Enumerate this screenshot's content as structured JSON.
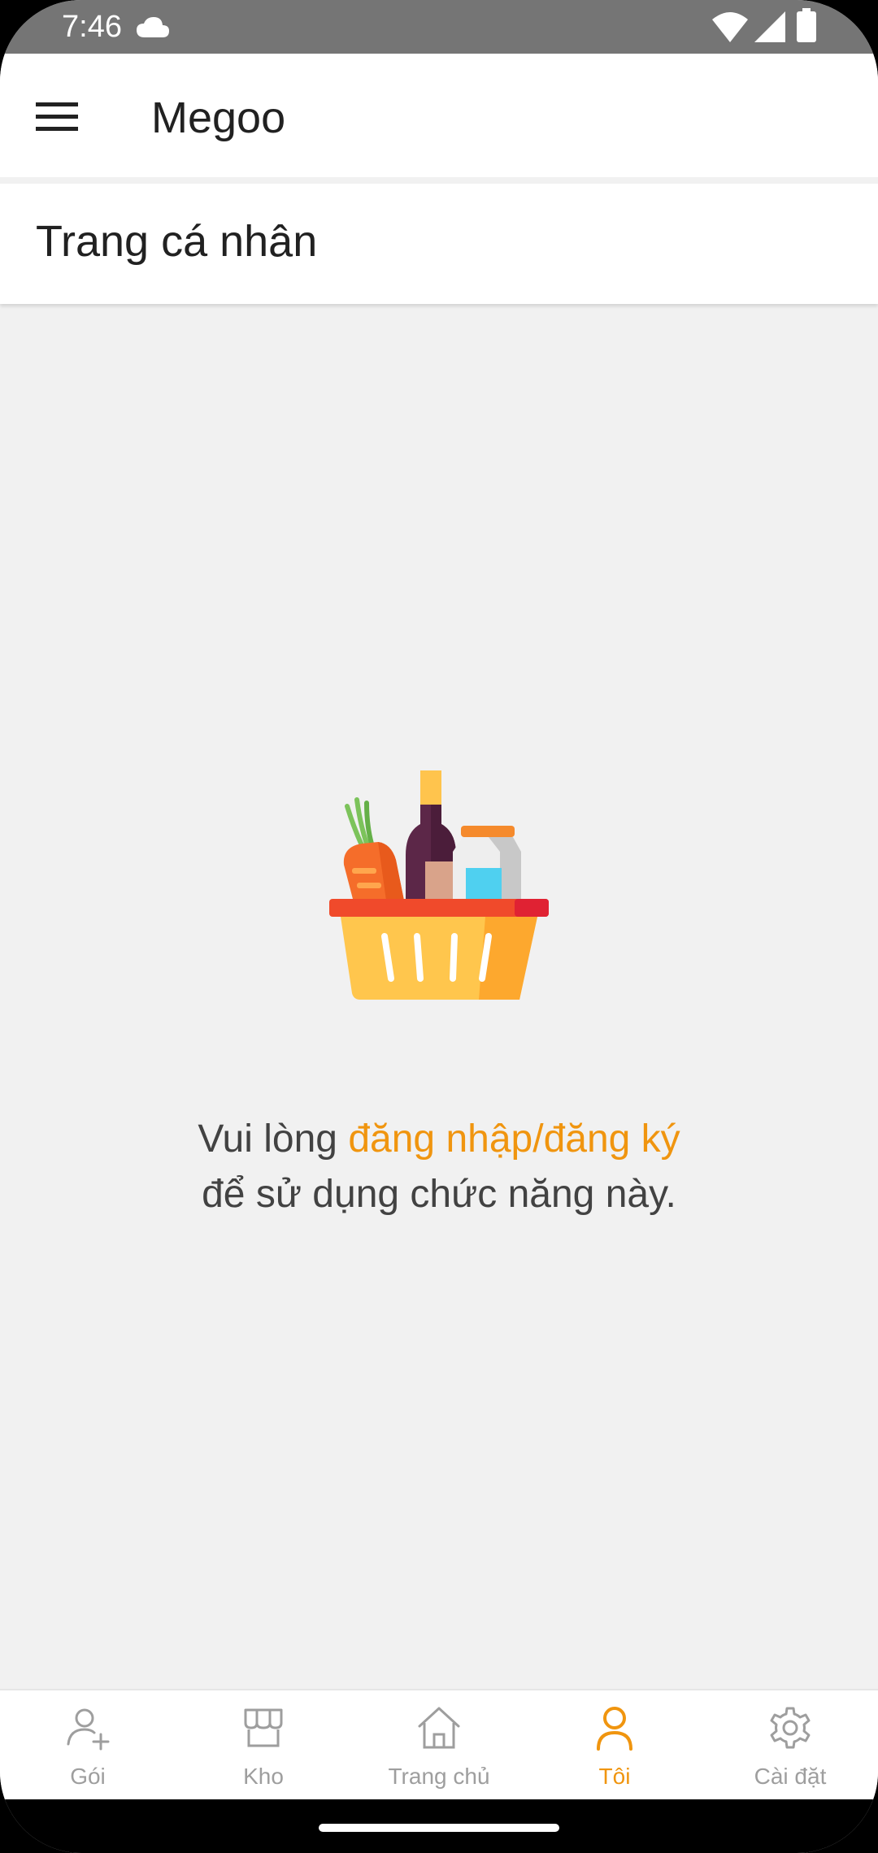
{
  "status_bar": {
    "time": "7:46",
    "icons": [
      "cloud-icon",
      "wifi-icon",
      "signal-icon",
      "battery-icon"
    ]
  },
  "app_bar": {
    "title": "Megoo",
    "menu_icon": "menu-icon"
  },
  "page": {
    "title": "Trang cá nhân"
  },
  "empty_state": {
    "illustration": "shopping-basket-icon",
    "message_prefix": "Vui lòng ",
    "login_link": "đăng nhập/đăng ký",
    "message_suffix": "để sử dụng chức năng này."
  },
  "bottom_nav": {
    "items": [
      {
        "label": "Gói",
        "icon": "add-user-icon",
        "active": false
      },
      {
        "label": "Kho",
        "icon": "store-icon",
        "active": false
      },
      {
        "label": "Trang chủ",
        "icon": "home-icon",
        "active": false
      },
      {
        "label": "Tôi",
        "icon": "user-icon",
        "active": true
      },
      {
        "label": "Cài đặt",
        "icon": "settings-icon",
        "active": false
      }
    ]
  },
  "colors": {
    "accent": "#f0950f",
    "background": "#f1f1f1",
    "status_bar": "#757575",
    "inactive": "#9e9e9e"
  }
}
